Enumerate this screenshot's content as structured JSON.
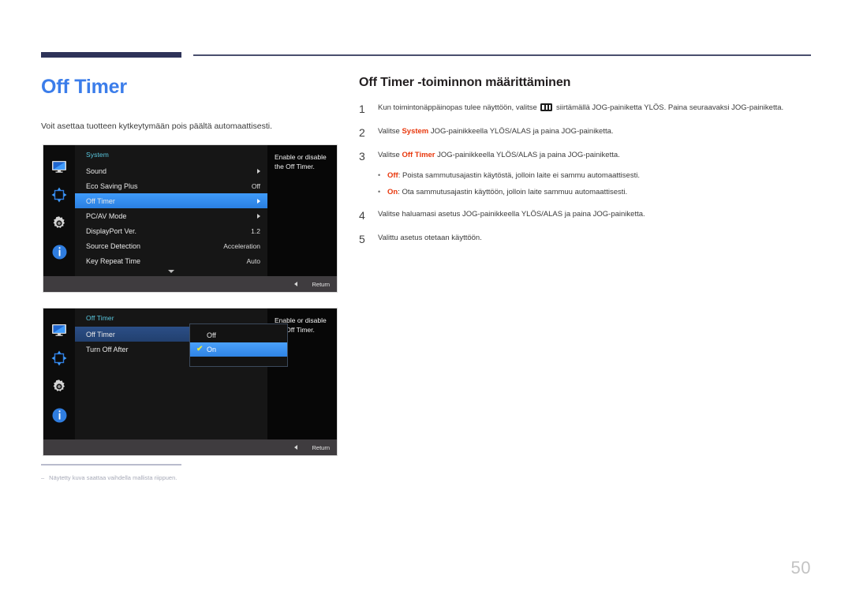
{
  "page": {
    "title": "Off Timer",
    "intro": "Voit asettaa tuotteen kytkeytymään pois päältä automaattisesti.",
    "number": "50",
    "footnote_dash": "‒",
    "footnote": "Näytetty kuva saattaa vaihdella mallista riippuen."
  },
  "section": {
    "title": "Off Timer -toiminnon määrittäminen",
    "steps": [
      {
        "num": "1",
        "pre": "Kun toimintonäppäinopas tulee näyttöön, valitse ",
        "post": " siirtämällä JOG-painiketta YLÖS. Paina seuraavaksi JOG-painiketta.",
        "icon": "menu-bars-icon"
      },
      {
        "num": "2",
        "pre": "Valitse ",
        "emph": "System",
        "post": " JOG-painikkeella YLÖS/ALAS ja paina JOG-painiketta."
      },
      {
        "num": "3",
        "pre": "Valitse ",
        "emph": "Off Timer",
        "post": " JOG-painikkeella YLÖS/ALAS ja paina JOG-painiketta."
      },
      {
        "num": "4",
        "pre": "Valitse haluamasi asetus JOG-painikkeella YLÖS/ALAS ja paina JOG-painiketta."
      },
      {
        "num": "5",
        "pre": "Valittu asetus otetaan käyttöön."
      }
    ],
    "bullets": [
      {
        "dot": "•",
        "emph": "Off",
        "text": ": Poista sammutusajastin käytöstä, jolloin laite ei sammu automaattisesti."
      },
      {
        "dot": "•",
        "emph": "On",
        "text": ": Ota sammutusajastin käyttöön, jolloin laite sammuu automaattisesti."
      }
    ]
  },
  "osd1": {
    "menu_title": "System",
    "rail_icons": [
      "monitor-icon",
      "move-arrows-icon",
      "gear-icon",
      "info-icon"
    ],
    "rows": [
      {
        "label": "Sound",
        "value": "",
        "arrow": true,
        "selected": false
      },
      {
        "label": "Eco Saving Plus",
        "value": "Off",
        "arrow": false,
        "selected": false
      },
      {
        "label": "Off Timer",
        "value": "",
        "arrow": true,
        "selected": true
      },
      {
        "label": "PC/AV Mode",
        "value": "",
        "arrow": true,
        "selected": false
      },
      {
        "label": "DisplayPort Ver.",
        "value": "1.2",
        "arrow": false,
        "selected": false
      },
      {
        "label": "Source Detection",
        "value": "Acceleration",
        "arrow": false,
        "selected": false
      },
      {
        "label": "Key Repeat Time",
        "value": "Auto",
        "arrow": false,
        "selected": false
      }
    ],
    "description": "Enable or disable the Off Timer.",
    "return_label": "Return"
  },
  "osd2": {
    "menu_title": "Off Timer",
    "rail_icons": [
      "monitor-icon",
      "move-arrows-icon",
      "gear-icon",
      "info-icon"
    ],
    "rows": [
      {
        "label": "Off Timer",
        "value": "",
        "arrow": false,
        "selected": true
      },
      {
        "label": "Turn Off After",
        "value": "",
        "arrow": false,
        "selected": false
      }
    ],
    "popup": [
      {
        "label": "Off",
        "checked": false
      },
      {
        "label": "On",
        "checked": true
      }
    ],
    "check_glyph": "✔",
    "description": "Enable or disable the Off Timer.",
    "return_label": "Return"
  },
  "colors": {
    "title_blue": "#3b7dea",
    "emphasis_red": "#e8380d",
    "rule_navy": "#2e3359",
    "osd_highlight": "#3f9bfb",
    "osd_menu_title": "#59c8e0",
    "check_yellow": "#e9e93a"
  }
}
